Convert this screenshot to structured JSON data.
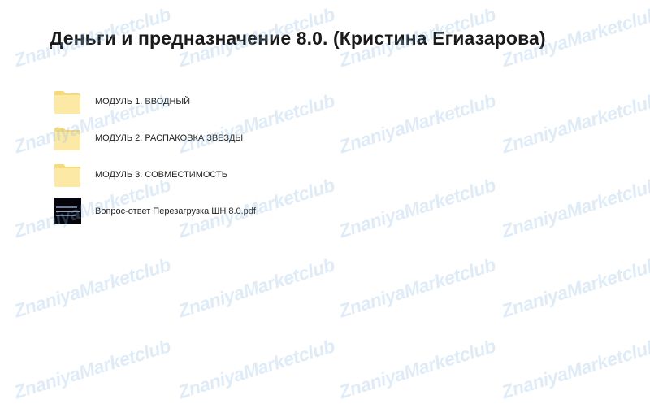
{
  "page": {
    "title": "Деньги и предназначение 8.0. (Кристина Егиазарова)"
  },
  "items": [
    {
      "type": "folder",
      "icon": "folder-icon",
      "name": "МОДУЛЬ 1. ВВОДНЫЙ"
    },
    {
      "type": "folder",
      "icon": "folder-icon",
      "name": "МОДУЛЬ 2. РАСПАКОВКА ЗВЕЗДЫ"
    },
    {
      "type": "folder",
      "icon": "folder-icon",
      "name": "МОДУЛЬ 3. СОВМЕСТИМОСТЬ"
    },
    {
      "type": "file",
      "icon": "pdf-thumbnail",
      "name": "Вопрос-ответ Перезагрузка ШН 8.0.pdf"
    }
  ],
  "watermark": {
    "text": "ZnaniyaMarketclub",
    "color": "#8cb9e1"
  },
  "colors": {
    "folder": "#fde9a6",
    "folder_edge": "#f6d978",
    "thumbnail_bg": "#04040a"
  }
}
